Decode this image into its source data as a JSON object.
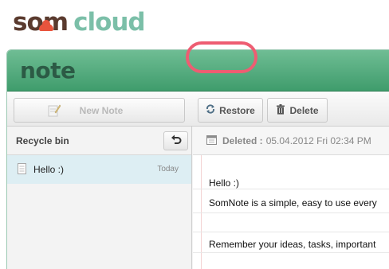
{
  "brand": {
    "part1": "som",
    "part2": "cloud"
  },
  "app": {
    "title": "note"
  },
  "toolbar": {
    "new_note_label": "New Note",
    "restore_label": "Restore",
    "delete_label": "Delete"
  },
  "sidebar": {
    "title": "Recycle bin",
    "items": [
      {
        "title": "Hello :)",
        "date": "Today"
      }
    ]
  },
  "note": {
    "status_label": "Deleted :",
    "status_date": "05.04.2012 Fri 02:34 PM",
    "lines": [
      "Hello :)",
      "SomNote is a simple, easy to use every",
      "",
      "Remember your ideas, tasks, important"
    ]
  },
  "colors": {
    "header_green": "#4ea77a",
    "brand_brown": "#5a3a2e",
    "brand_teal": "#7bbfa8",
    "highlight": "#ee5d72"
  }
}
